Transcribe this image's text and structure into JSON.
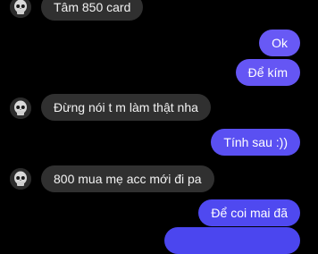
{
  "colors": {
    "background": "#000000",
    "incoming_bubble": "#303030",
    "incoming_text": "#f2f2f2",
    "outgoing_top": "#6a5cf6",
    "outgoing_bottom": "#4d47f0",
    "outgoing_text": "#ffffff"
  },
  "conversation": {
    "messages": [
      {
        "direction": "incoming",
        "text": "Tâm 850 card",
        "has_avatar": true
      },
      {
        "direction": "outgoing",
        "text": "Ok"
      },
      {
        "direction": "outgoing",
        "text": "Để kím"
      },
      {
        "direction": "incoming",
        "text": "Đừng nói t m làm thật nha",
        "has_avatar": true
      },
      {
        "direction": "outgoing",
        "text": "Tính sau :))"
      },
      {
        "direction": "incoming",
        "text": "800 mua mẹ acc mới đi pa",
        "has_avatar": true
      },
      {
        "direction": "outgoing",
        "text": "Để coi mai đã"
      },
      {
        "direction": "outgoing",
        "text": ""
      }
    ]
  }
}
